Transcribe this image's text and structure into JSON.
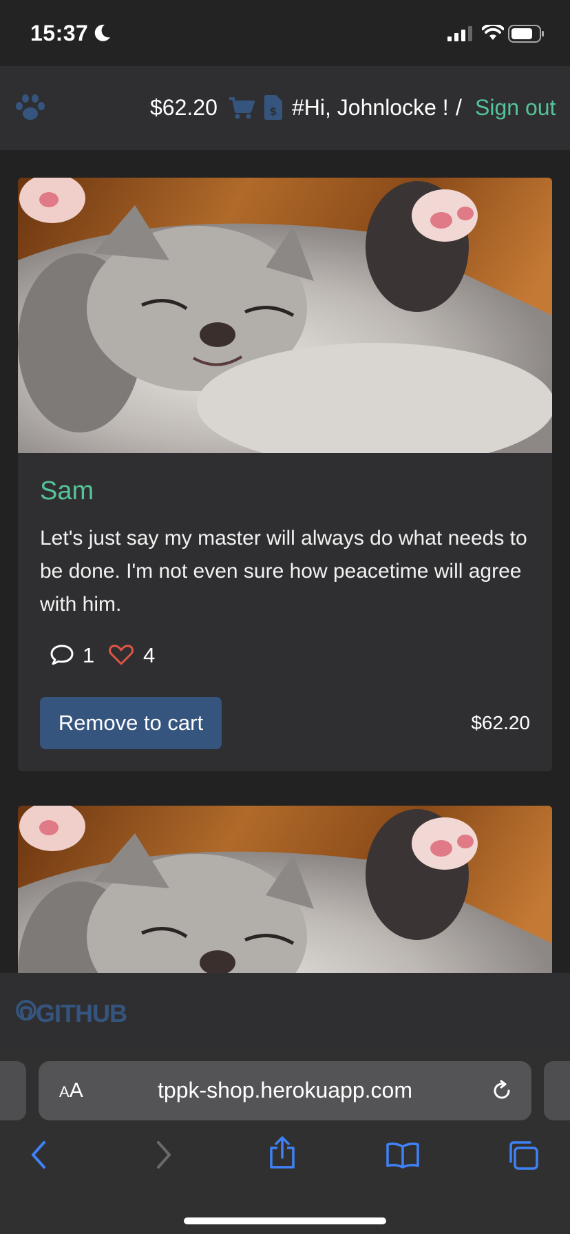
{
  "status_bar": {
    "time": "15:37"
  },
  "navbar": {
    "cart_total": "$62.20",
    "greeting": "#Hi, Johnlocke !",
    "separator": "/",
    "sign_out": "Sign out"
  },
  "products": [
    {
      "name": "Sam",
      "description": "Let's just say my master will always do what needs to be done. I'm not even sure how peacetime will agree with him.",
      "comments": "1",
      "likes": "4",
      "button_label": "Remove to cart",
      "price": "$62.20"
    }
  ],
  "footer": {
    "github_label": "GITHUB"
  },
  "browser": {
    "text_size_label": "AA",
    "url": "tppk-shop.herokuapp.com"
  },
  "colors": {
    "accent_green": "#55c39a",
    "brand_blue": "#35557f",
    "heart_red": "#e05545",
    "safari_blue": "#3f82f7"
  }
}
